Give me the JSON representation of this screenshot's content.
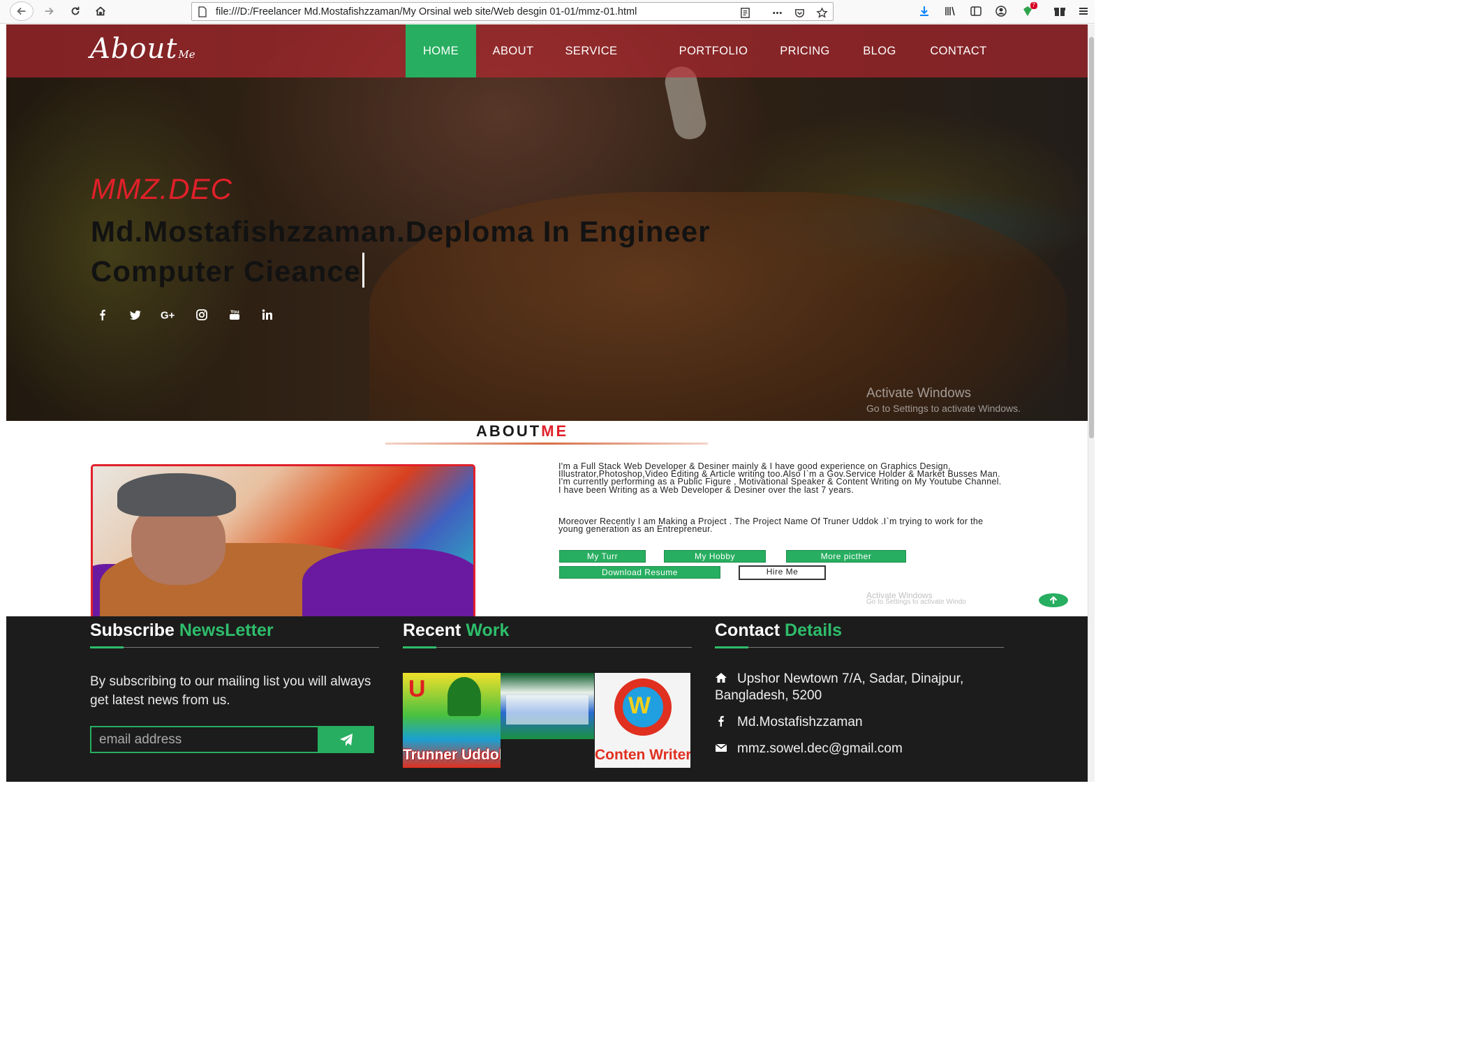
{
  "browser": {
    "url": "file:///D:/Freelancer Md.Mostafishzzaman/My Orsinal web site/Web desgin 01-01/mmz-01.html",
    "extension_badge": "7"
  },
  "brand": {
    "main": "About",
    "sub": "Me"
  },
  "nav": {
    "items": [
      {
        "label": "HOME",
        "active": true
      },
      {
        "label": "ABOUT"
      },
      {
        "label": "SERVICE"
      },
      {
        "label": "PORTFOLIO"
      },
      {
        "label": "PRICING"
      },
      {
        "label": "BLOG"
      },
      {
        "label": "CONTACT"
      }
    ],
    "active_color": "#27ae60",
    "bar_color": "#be2832"
  },
  "hero": {
    "tag": "MMZ.DEC",
    "title": "Md.Mostafishzzaman.Deploma In Engineer Computer Cieance",
    "social": [
      "facebook-icon",
      "twitter-icon",
      "google-plus-icon",
      "instagram-icon",
      "youtube-icon",
      "linkedin-icon"
    ],
    "watermark": {
      "line1": "Activate Windows",
      "line2": "Go to Settings to activate Windows."
    }
  },
  "about": {
    "heading_a": "ABOUT",
    "heading_b": "ME",
    "paragraph1": "I'm a Full Stack Web Developer & Desiner mainly & I have good experience on Graphics Design, Illustrator,Photoshop,Video Editing & Article writing too.Also I`m a Gov.Service Holder & Market Busses Man. I'm currently performing as a Public Figure , Motivational Speaker & Content Writing on My Youtube Channel. I have been Writing as a Web Developer & Desiner over the last 7 years.",
    "paragraph2": "Moreover Recently I am Making a Project . The Project Name Of Truner Uddok .I`m trying to work for the young generation as an Entrepreneur.",
    "buttons": {
      "my_turr": "My Turr",
      "my_hobby": "My Hobby",
      "more_picther": "More picther",
      "download_resume": "Download Resume",
      "hire_me": "Hire Me"
    },
    "watermark": {
      "line1": "Activate Windows",
      "line2": "Go to Settings to activate Windo"
    }
  },
  "footer": {
    "subscribe": {
      "title_a": "Subscribe",
      "title_b": "NewsLetter",
      "description": "By subscribing to our mailing list you will always get latest news from us.",
      "email_placeholder": "email address"
    },
    "recent_work": {
      "title_a": "Recent",
      "title_b": "Work",
      "items": [
        {
          "caption": "Trunner Uddok",
          "letter": "U"
        },
        {
          "caption": ""
        },
        {
          "caption": "Conten Writer",
          "letter": "W"
        }
      ]
    },
    "contact": {
      "title_a": "Contact",
      "title_b": "Details",
      "address": "Upshor Newtown 7/A, Sadar, Dinajpur, Bangladesh, 5200",
      "facebook": "Md.Mostafishzzaman",
      "email": "mmz.sowel.dec@gmail.com"
    },
    "accent_color": "#2ebd6b"
  }
}
